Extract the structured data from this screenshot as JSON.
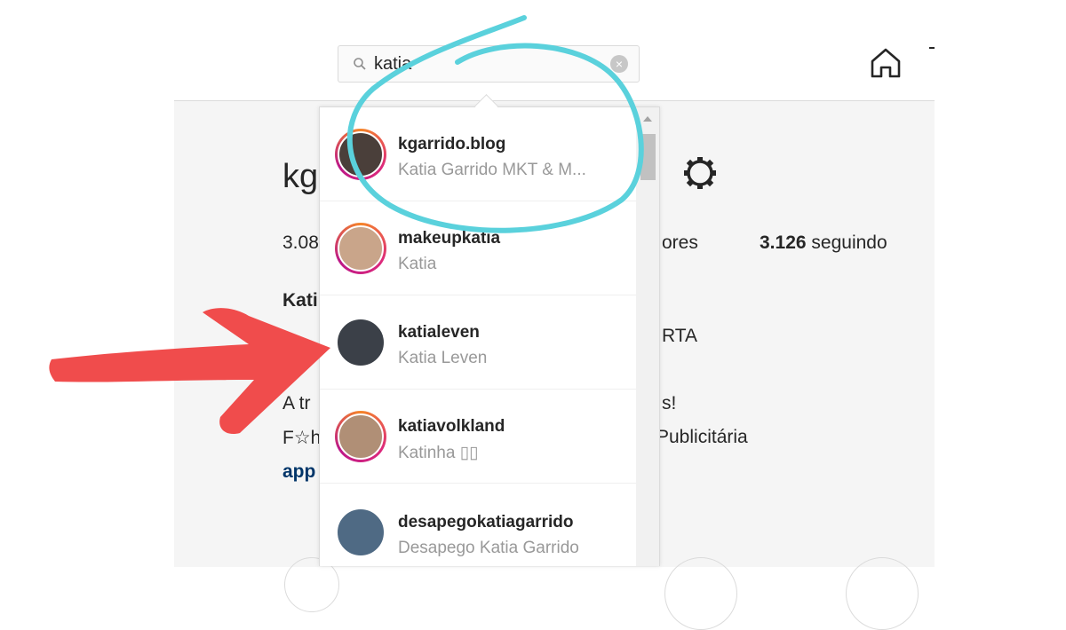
{
  "search": {
    "value": "katia"
  },
  "profile_background": {
    "username_partial": "kg",
    "posts_partial": "3.08",
    "followers_partial": "ores",
    "following_count": "3.126",
    "following_label": "seguindo",
    "name_partial": "Kati",
    "bio_line1_partial": "RTA",
    "bio_line2_left": "A tr",
    "bio_line2_right": "s!",
    "bio_line3_left": "F☆h",
    "bio_line3_right": "Publicitária",
    "link_partial": "app"
  },
  "results": [
    {
      "username": "kgarrido.blog",
      "fullname": "Katia Garrido MKT & M...",
      "story_ring": true,
      "avatar_color": "#4a3f3a"
    },
    {
      "username": "makeupkatia",
      "fullname": "Katia",
      "story_ring": true,
      "avatar_color": "#c9a58a"
    },
    {
      "username": "katialeven",
      "fullname": "Katia Leven",
      "story_ring": false,
      "avatar_color": "#3b4048"
    },
    {
      "username": "katiavolkland",
      "fullname": "Katinha ▯▯",
      "story_ring": true,
      "avatar_color": "#b08f76"
    },
    {
      "username": "desapegokatiagarrido",
      "fullname": "Desapego Katia Garrido",
      "story_ring": false,
      "avatar_color": "#4f6a84"
    }
  ],
  "colors": {
    "annotation_circle": "#5ad1dc",
    "annotation_arrow": "#f04c4c",
    "story_ring": "#dd2a7b"
  },
  "icons": [
    "search-icon",
    "clear-icon",
    "home-icon",
    "gear-icon"
  ]
}
